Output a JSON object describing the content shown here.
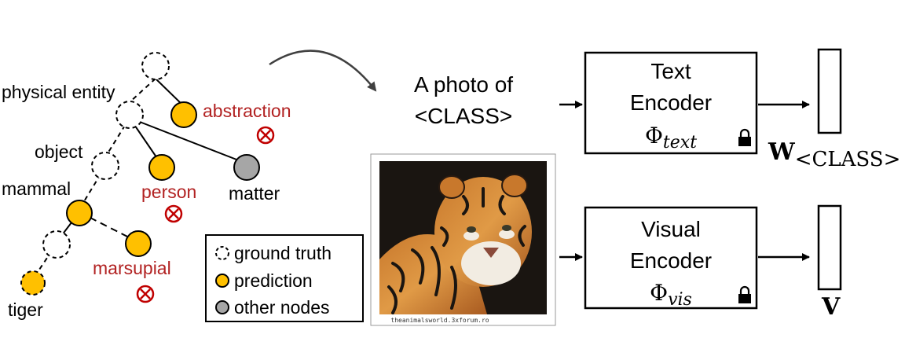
{
  "tree": {
    "labels": {
      "physical_entity": "physical entity",
      "abstraction": "abstraction",
      "object": "object",
      "person": "person",
      "matter": "matter",
      "mammal": "mammal",
      "marsupial": "marsupial",
      "tiger": "tiger"
    }
  },
  "legend": {
    "ground_truth": "ground truth",
    "prediction": "prediction",
    "other_nodes": "other nodes"
  },
  "prompt": {
    "line1": "A photo of",
    "line2": "<CLASS>"
  },
  "text_encoder": {
    "line1": "Text",
    "line2": "Encoder",
    "symbol": "Φ",
    "subscript": "text"
  },
  "visual_encoder": {
    "line1": "Visual",
    "line2": "Encoder",
    "symbol": "Φ",
    "subscript": "vis"
  },
  "outputs": {
    "w_label": "W",
    "w_subscript": "<CLASS>",
    "v_label": "V"
  },
  "image": {
    "watermark": "theanimalsworld.3xforum.ro"
  },
  "colors": {
    "prediction": "#FFC000",
    "other": "#A6A6A6",
    "error": "#C00000",
    "label_red": "#B22222",
    "stroke": "#000000"
  },
  "icons": [
    "wrong-mark-icon",
    "lock-icon",
    "arrow-icon"
  ]
}
